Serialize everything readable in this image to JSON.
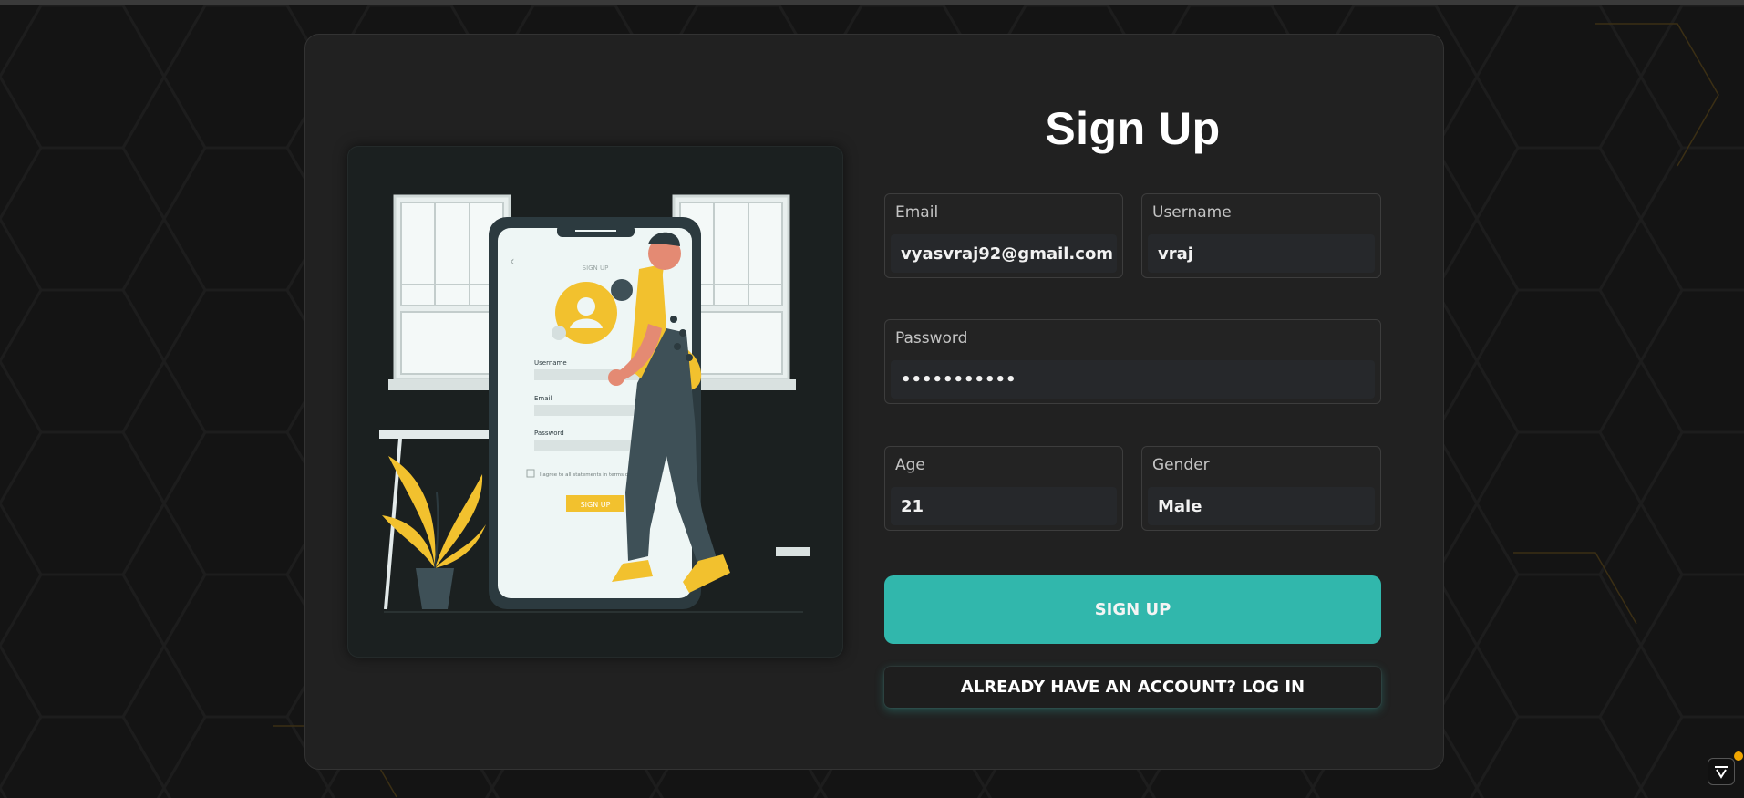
{
  "page": {
    "title": "Sign Up"
  },
  "illustration": {
    "screen_heading": "SIGN UP",
    "username_label": "Username",
    "email_label": "Email",
    "password_label": "Password",
    "terms_text": "I agree to all statements in terms of service",
    "button_label": "SIGN UP"
  },
  "form": {
    "email": {
      "label": "Email",
      "value": "vyasvraj92@gmail.com"
    },
    "username": {
      "label": "Username",
      "value": "vraj"
    },
    "password": {
      "label": "Password",
      "value": "•••••••••••"
    },
    "age": {
      "label": "Age",
      "value": "21"
    },
    "gender": {
      "label": "Gender",
      "value": "Male"
    }
  },
  "actions": {
    "signup_label": "SIGN UP",
    "login_label": "ALREADY HAVE AN ACCOUNT? LOG IN"
  },
  "colors": {
    "background": "#141414",
    "card": "#212121",
    "accent": "#31b7ac",
    "illustration_yellow": "#f2c12e"
  }
}
